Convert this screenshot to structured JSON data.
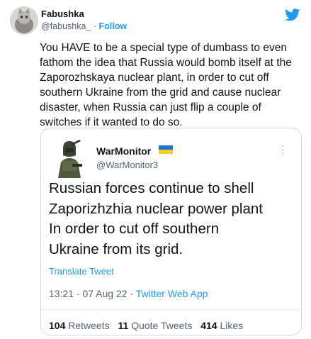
{
  "tweet": {
    "author_name": "Fabushka",
    "handle": "@fabushka_",
    "separator": "·",
    "follow_label": "Follow",
    "text": "You HAVE to be a special type of dumbass to even\nfathom the idea that Russia would bomb itself at the\nZaporozhskaya nuclear plant, in order to cut off\nsouthern Ukraine from the grid and cause nuclear\ndisaster, when Russia can just flip a couple of\nswitches if it wanted to do so."
  },
  "quoted": {
    "author_name": "WarMonitor",
    "handle": "@WarMonitor3",
    "text": "Russian forces continue to shell\nZaporizhzhia nuclear power plant\nIn order to cut off southern\nUkraine from its grid.",
    "translate_label": "Translate Tweet",
    "time": "13:21 · 07 Aug 22 · ",
    "app": "Twitter Web App",
    "retweets_count": "104",
    "retweets_label": "Retweets",
    "quotes_count": "11",
    "quotes_label": "Quote Tweets",
    "likes_count": "414",
    "likes_label": "Likes"
  },
  "colors": {
    "accent": "#1d9bf0",
    "text": "#0f1419",
    "muted": "#536471",
    "border": "#cfd9de"
  },
  "icons": {
    "brand": "twitter-bird-icon",
    "more": "more-options-icon",
    "flag": "ukraine-flag-icon"
  }
}
